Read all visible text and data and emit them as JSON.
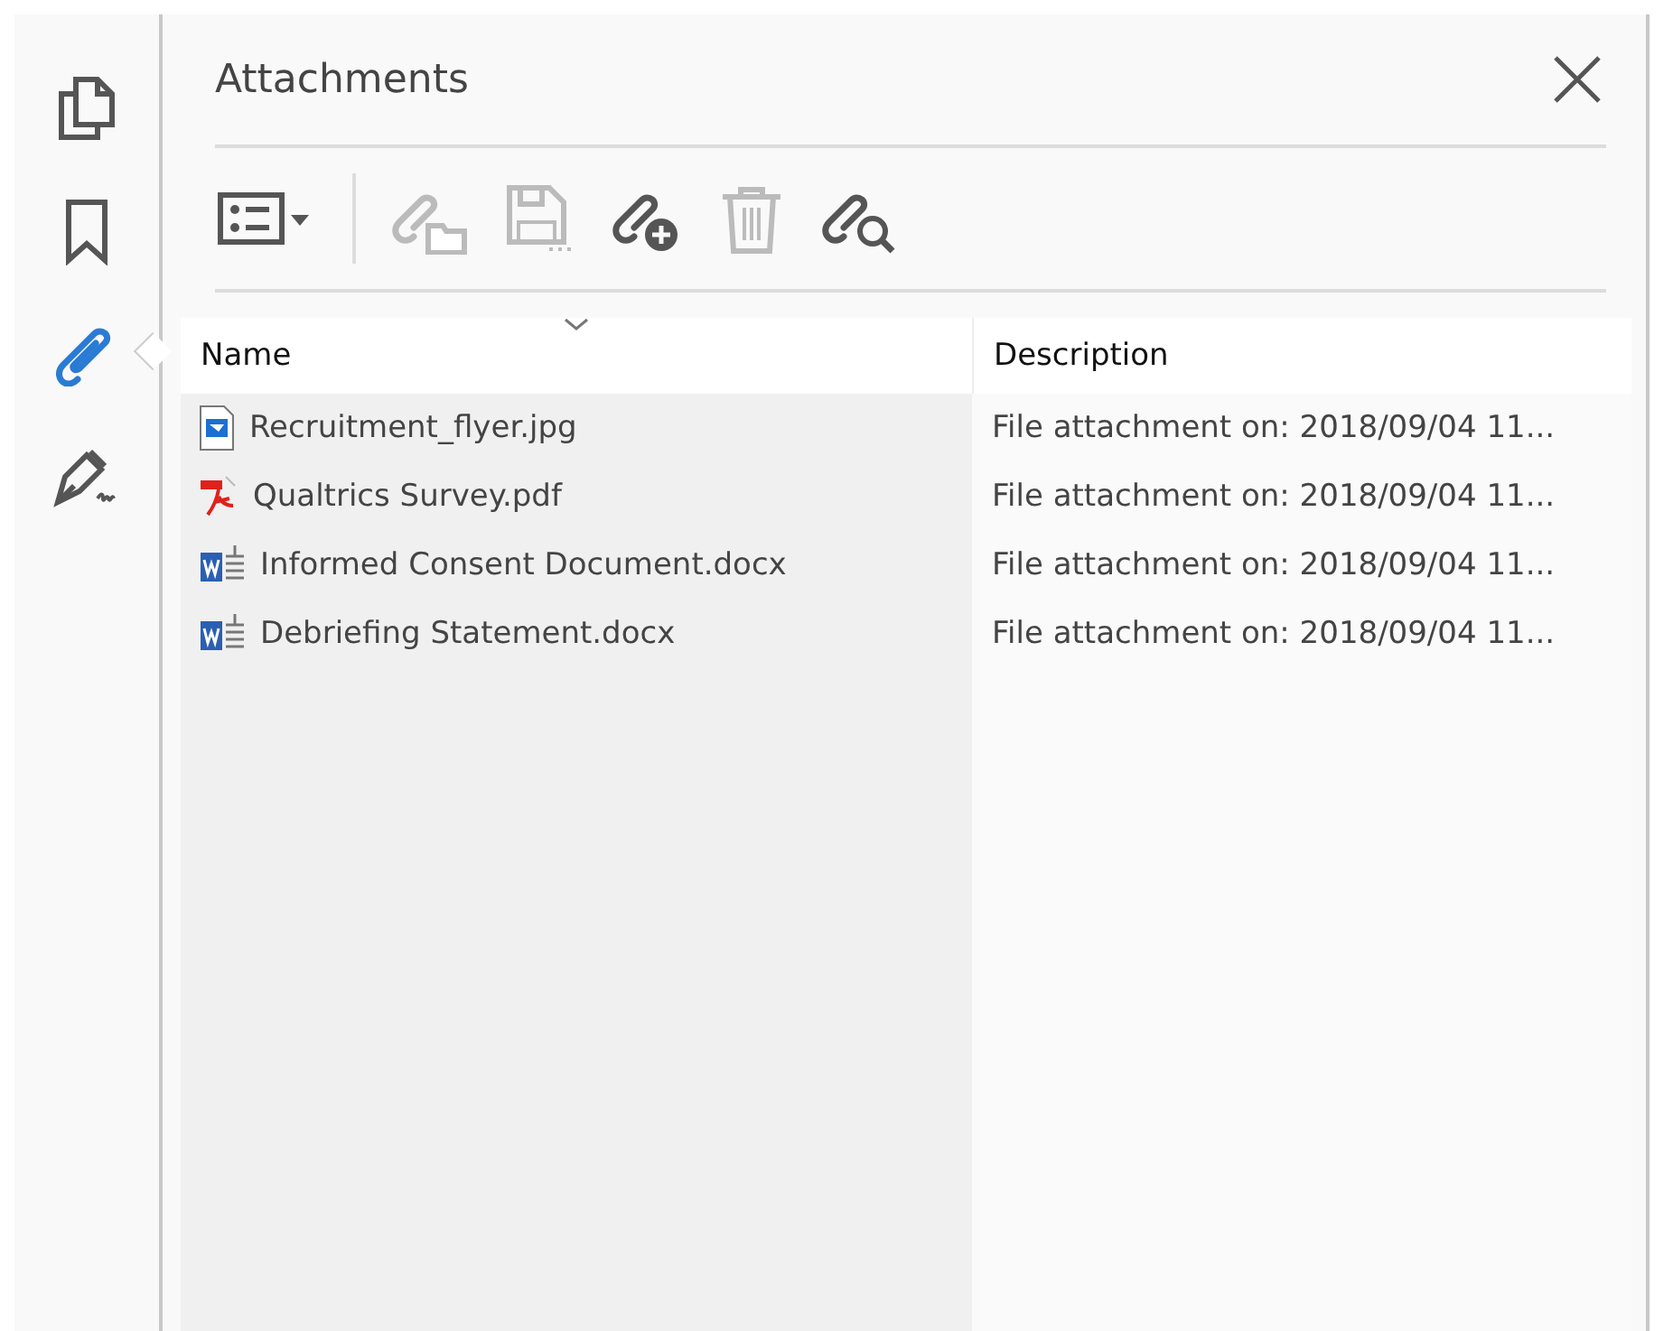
{
  "rail": [
    {
      "kind": "pages",
      "selected": false
    },
    {
      "kind": "bookmark",
      "selected": false
    },
    {
      "kind": "attachment",
      "selected": true
    },
    {
      "kind": "signature",
      "selected": false
    }
  ],
  "panel": {
    "title": "Attachments"
  },
  "toolbar": [
    {
      "kind": "options",
      "disabled": false
    },
    {
      "kind": "open",
      "disabled": true
    },
    {
      "kind": "save",
      "disabled": true
    },
    {
      "kind": "add",
      "disabled": false
    },
    {
      "kind": "delete",
      "disabled": true
    },
    {
      "kind": "search",
      "disabled": false
    }
  ],
  "table": {
    "columns": [
      {
        "label": "Name",
        "sorted": true
      },
      {
        "label": "Description",
        "sorted": false
      }
    ],
    "rows": [
      {
        "kind": "image",
        "name": "Recruitment_flyer.jpg",
        "description": "File attachment on: 2018/09/04 11..."
      },
      {
        "kind": "pdf",
        "name": "Qualtrics Survey.pdf",
        "description": "File attachment on: 2018/09/04 11..."
      },
      {
        "kind": "word",
        "name": "Informed Consent Document.docx",
        "description": "File attachment on: 2018/09/04 11..."
      },
      {
        "kind": "word",
        "name": "Debriefing Statement.docx",
        "description": "File attachment on: 2018/09/04 11..."
      }
    ]
  }
}
